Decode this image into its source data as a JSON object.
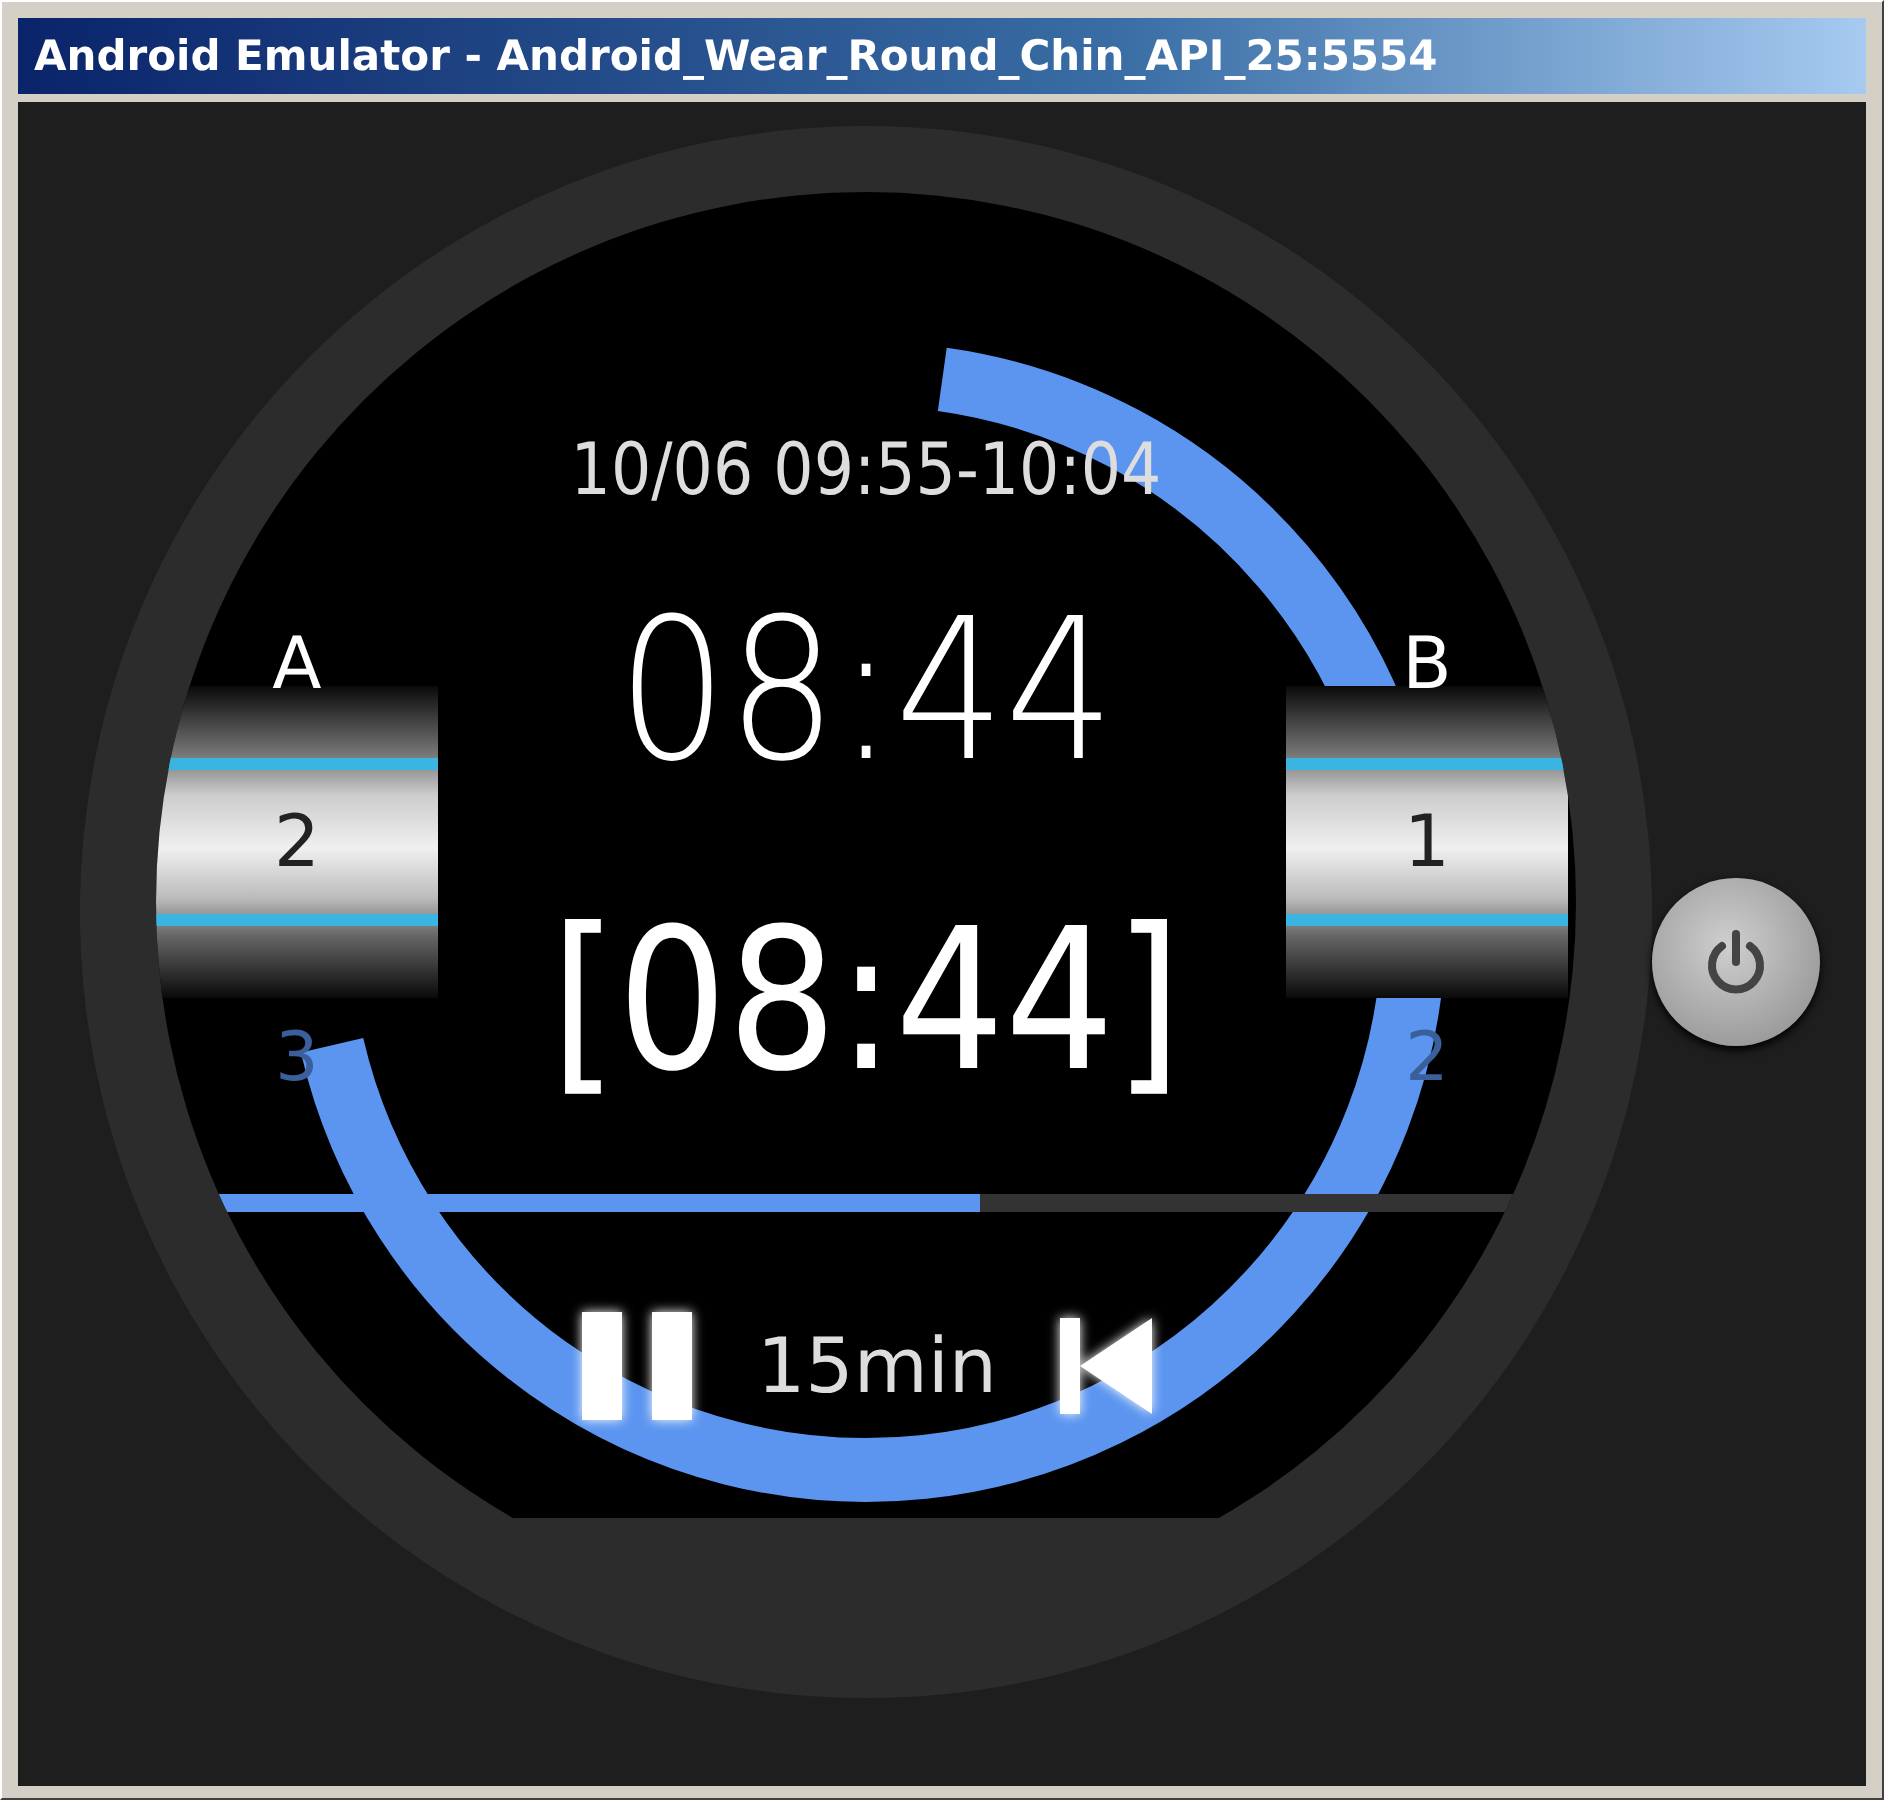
{
  "window": {
    "title": "Android Emulator - Android_Wear_Round_Chin_API_25:5554"
  },
  "watch": {
    "schedule": "10/06 09:55-10:04",
    "remaining": "08:44",
    "remaining_bracketed": "[08:44]",
    "pickers": [
      {
        "label": "A",
        "value": "2",
        "next": "3"
      },
      {
        "label": "B",
        "value": "1",
        "next": "2"
      }
    ],
    "progress": {
      "level": 0.59
    },
    "duration": "15min"
  }
}
